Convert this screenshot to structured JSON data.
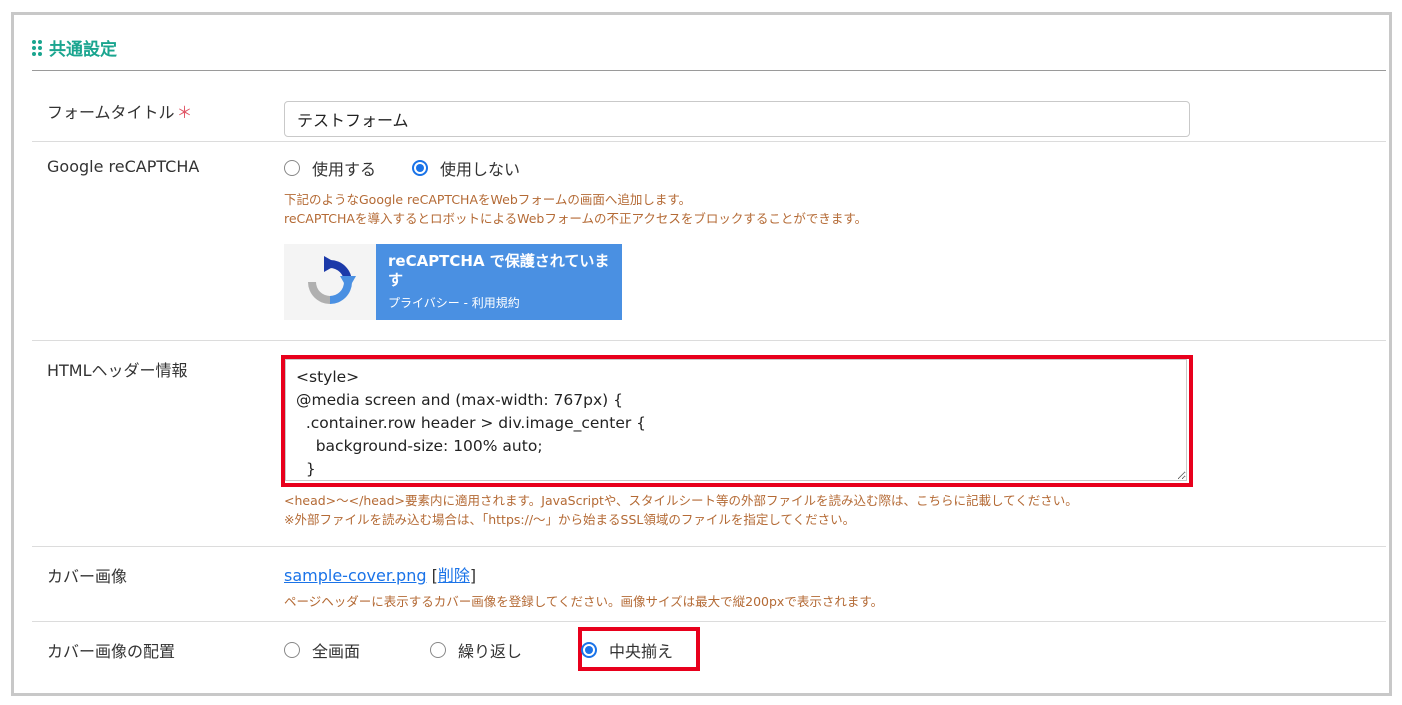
{
  "section": {
    "title": "共通設定"
  },
  "rows": {
    "form_title": {
      "label": "フォームタイトル",
      "required_mark": "＊",
      "value": "テストフォーム"
    },
    "recaptcha": {
      "label": "Google reCAPTCHA",
      "options": [
        "使用する",
        "使用しない"
      ],
      "selected": "使用しない",
      "help_line1": "下記のようなGoogle reCAPTCHAをWebフォームの画面へ追加します。",
      "help_line2": "reCAPTCHAを導入するとロボットによるWebフォームの不正アクセスをブロックすることができます。",
      "badge_title": "reCAPTCHA で保護されています",
      "badge_links": "プライバシー - 利用規約"
    },
    "html_header": {
      "label": "HTMLヘッダー情報",
      "code_lines": [
        "<style>",
        "@media screen and (max-width: 767px) {",
        "  .container.row header > div.image_center {",
        "    background-size: 100% auto;",
        "  }"
      ],
      "help_line1": "<head>〜</head>要素内に適用されます。JavaScriptや、スタイルシート等の外部ファイルを読み込む際は、こちらに記載してください。",
      "help_line2": "※外部ファイルを読み込む場合は、「https://〜」から始まるSSL領域のファイルを指定してください。"
    },
    "cover_image": {
      "label": "カバー画像",
      "file_name": "sample-cover.png",
      "delete_open": "[",
      "delete_label": "削除",
      "delete_close": "]",
      "help": "ページヘッダーに表示するカバー画像を登録してください。画像サイズは最大で縦200pxで表示されます。"
    },
    "cover_position": {
      "label": "カバー画像の配置",
      "options": [
        "全画面",
        "繰り返し",
        "中央揃え"
      ],
      "selected": "中央揃え"
    }
  },
  "colors": {
    "accent": "#1aa58f",
    "help_text": "#b46a35",
    "highlight": "#e8001c",
    "radio_checked": "#1a73e8",
    "recaptcha_panel": "#4a90e2"
  }
}
